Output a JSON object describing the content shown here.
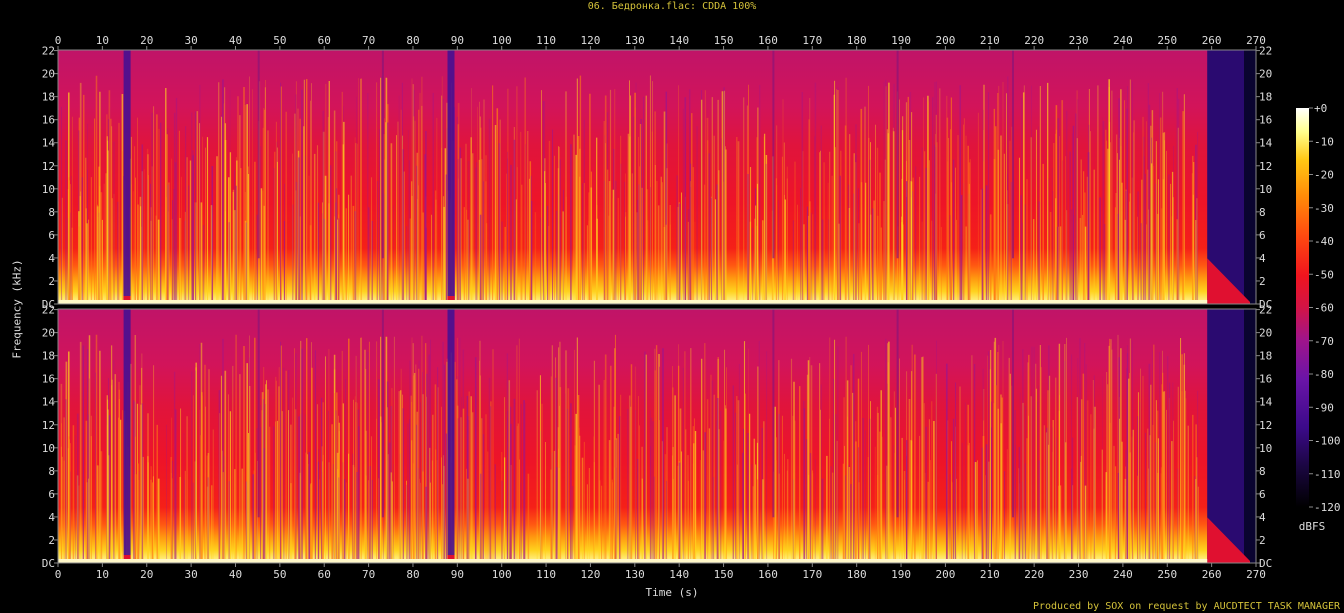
{
  "title": "06. Бедронка.flac: CDDA 100%",
  "footer": "Produced by SOX on request by AUCDTECT TASK MANAGER",
  "chart_data": {
    "type": "heatmap",
    "xlabel": "Time (s)",
    "ylabel": "Frequency (kHz)",
    "xlim": [
      0,
      270
    ],
    "x_ticks": [
      "0",
      "10",
      "20",
      "30",
      "40",
      "50",
      "60",
      "70",
      "80",
      "90",
      "100",
      "110",
      "120",
      "130",
      "140",
      "150",
      "160",
      "170",
      "180",
      "190",
      "200",
      "210",
      "220",
      "230",
      "240",
      "250",
      "260",
      "270"
    ],
    "ylim_khz": [
      0,
      22.05
    ],
    "y_ticks": [
      "DC",
      "2",
      "4",
      "6",
      "8",
      "10",
      "12",
      "14",
      "16",
      "18",
      "20",
      "22"
    ],
    "channels": 2,
    "colorbar": {
      "label": "dBFS",
      "range": [
        -120,
        0
      ],
      "ticks": [
        "+0",
        "-10",
        "-20",
        "-30",
        "-40",
        "-50",
        "-60",
        "-70",
        "-80",
        "-90",
        "-100",
        "-110",
        "-120"
      ],
      "colors": [
        "#000000",
        "#1a0640",
        "#3c0a8a",
        "#6a14a8",
        "#a0148a",
        "#d21446",
        "#f0141e",
        "#ff4a10",
        "#ff8c08",
        "#ffc814",
        "#ffff8c",
        "#ffffff"
      ]
    },
    "features": {
      "quiet_gaps_s": [
        15,
        88
      ],
      "level_drops_s": [
        45,
        73,
        161,
        189,
        215
      ],
      "music_end_s": 258,
      "highest_energy_band_khz": [
        0,
        3
      ]
    }
  }
}
